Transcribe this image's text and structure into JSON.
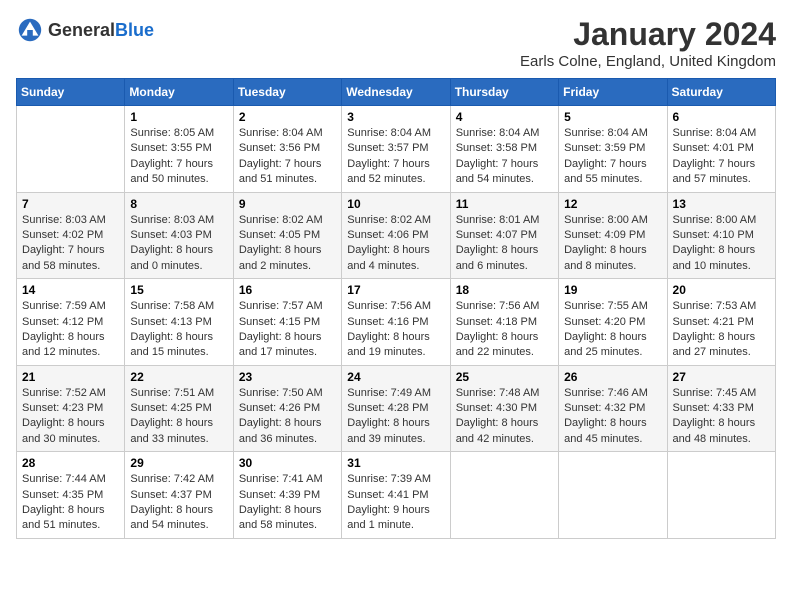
{
  "header": {
    "logo_general": "General",
    "logo_blue": "Blue",
    "month_year": "January 2024",
    "location": "Earls Colne, England, United Kingdom"
  },
  "days_of_week": [
    "Sunday",
    "Monday",
    "Tuesday",
    "Wednesday",
    "Thursday",
    "Friday",
    "Saturday"
  ],
  "weeks": [
    [
      {
        "day": "",
        "sunrise": "",
        "sunset": "",
        "daylight": ""
      },
      {
        "day": "1",
        "sunrise": "Sunrise: 8:05 AM",
        "sunset": "Sunset: 3:55 PM",
        "daylight": "Daylight: 7 hours and 50 minutes."
      },
      {
        "day": "2",
        "sunrise": "Sunrise: 8:04 AM",
        "sunset": "Sunset: 3:56 PM",
        "daylight": "Daylight: 7 hours and 51 minutes."
      },
      {
        "day": "3",
        "sunrise": "Sunrise: 8:04 AM",
        "sunset": "Sunset: 3:57 PM",
        "daylight": "Daylight: 7 hours and 52 minutes."
      },
      {
        "day": "4",
        "sunrise": "Sunrise: 8:04 AM",
        "sunset": "Sunset: 3:58 PM",
        "daylight": "Daylight: 7 hours and 54 minutes."
      },
      {
        "day": "5",
        "sunrise": "Sunrise: 8:04 AM",
        "sunset": "Sunset: 3:59 PM",
        "daylight": "Daylight: 7 hours and 55 minutes."
      },
      {
        "day": "6",
        "sunrise": "Sunrise: 8:04 AM",
        "sunset": "Sunset: 4:01 PM",
        "daylight": "Daylight: 7 hours and 57 minutes."
      }
    ],
    [
      {
        "day": "7",
        "sunrise": "Sunrise: 8:03 AM",
        "sunset": "Sunset: 4:02 PM",
        "daylight": "Daylight: 7 hours and 58 minutes."
      },
      {
        "day": "8",
        "sunrise": "Sunrise: 8:03 AM",
        "sunset": "Sunset: 4:03 PM",
        "daylight": "Daylight: 8 hours and 0 minutes."
      },
      {
        "day": "9",
        "sunrise": "Sunrise: 8:02 AM",
        "sunset": "Sunset: 4:05 PM",
        "daylight": "Daylight: 8 hours and 2 minutes."
      },
      {
        "day": "10",
        "sunrise": "Sunrise: 8:02 AM",
        "sunset": "Sunset: 4:06 PM",
        "daylight": "Daylight: 8 hours and 4 minutes."
      },
      {
        "day": "11",
        "sunrise": "Sunrise: 8:01 AM",
        "sunset": "Sunset: 4:07 PM",
        "daylight": "Daylight: 8 hours and 6 minutes."
      },
      {
        "day": "12",
        "sunrise": "Sunrise: 8:00 AM",
        "sunset": "Sunset: 4:09 PM",
        "daylight": "Daylight: 8 hours and 8 minutes."
      },
      {
        "day": "13",
        "sunrise": "Sunrise: 8:00 AM",
        "sunset": "Sunset: 4:10 PM",
        "daylight": "Daylight: 8 hours and 10 minutes."
      }
    ],
    [
      {
        "day": "14",
        "sunrise": "Sunrise: 7:59 AM",
        "sunset": "Sunset: 4:12 PM",
        "daylight": "Daylight: 8 hours and 12 minutes."
      },
      {
        "day": "15",
        "sunrise": "Sunrise: 7:58 AM",
        "sunset": "Sunset: 4:13 PM",
        "daylight": "Daylight: 8 hours and 15 minutes."
      },
      {
        "day": "16",
        "sunrise": "Sunrise: 7:57 AM",
        "sunset": "Sunset: 4:15 PM",
        "daylight": "Daylight: 8 hours and 17 minutes."
      },
      {
        "day": "17",
        "sunrise": "Sunrise: 7:56 AM",
        "sunset": "Sunset: 4:16 PM",
        "daylight": "Daylight: 8 hours and 19 minutes."
      },
      {
        "day": "18",
        "sunrise": "Sunrise: 7:56 AM",
        "sunset": "Sunset: 4:18 PM",
        "daylight": "Daylight: 8 hours and 22 minutes."
      },
      {
        "day": "19",
        "sunrise": "Sunrise: 7:55 AM",
        "sunset": "Sunset: 4:20 PM",
        "daylight": "Daylight: 8 hours and 25 minutes."
      },
      {
        "day": "20",
        "sunrise": "Sunrise: 7:53 AM",
        "sunset": "Sunset: 4:21 PM",
        "daylight": "Daylight: 8 hours and 27 minutes."
      }
    ],
    [
      {
        "day": "21",
        "sunrise": "Sunrise: 7:52 AM",
        "sunset": "Sunset: 4:23 PM",
        "daylight": "Daylight: 8 hours and 30 minutes."
      },
      {
        "day": "22",
        "sunrise": "Sunrise: 7:51 AM",
        "sunset": "Sunset: 4:25 PM",
        "daylight": "Daylight: 8 hours and 33 minutes."
      },
      {
        "day": "23",
        "sunrise": "Sunrise: 7:50 AM",
        "sunset": "Sunset: 4:26 PM",
        "daylight": "Daylight: 8 hours and 36 minutes."
      },
      {
        "day": "24",
        "sunrise": "Sunrise: 7:49 AM",
        "sunset": "Sunset: 4:28 PM",
        "daylight": "Daylight: 8 hours and 39 minutes."
      },
      {
        "day": "25",
        "sunrise": "Sunrise: 7:48 AM",
        "sunset": "Sunset: 4:30 PM",
        "daylight": "Daylight: 8 hours and 42 minutes."
      },
      {
        "day": "26",
        "sunrise": "Sunrise: 7:46 AM",
        "sunset": "Sunset: 4:32 PM",
        "daylight": "Daylight: 8 hours and 45 minutes."
      },
      {
        "day": "27",
        "sunrise": "Sunrise: 7:45 AM",
        "sunset": "Sunset: 4:33 PM",
        "daylight": "Daylight: 8 hours and 48 minutes."
      }
    ],
    [
      {
        "day": "28",
        "sunrise": "Sunrise: 7:44 AM",
        "sunset": "Sunset: 4:35 PM",
        "daylight": "Daylight: 8 hours and 51 minutes."
      },
      {
        "day": "29",
        "sunrise": "Sunrise: 7:42 AM",
        "sunset": "Sunset: 4:37 PM",
        "daylight": "Daylight: 8 hours and 54 minutes."
      },
      {
        "day": "30",
        "sunrise": "Sunrise: 7:41 AM",
        "sunset": "Sunset: 4:39 PM",
        "daylight": "Daylight: 8 hours and 58 minutes."
      },
      {
        "day": "31",
        "sunrise": "Sunrise: 7:39 AM",
        "sunset": "Sunset: 4:41 PM",
        "daylight": "Daylight: 9 hours and 1 minute."
      },
      {
        "day": "",
        "sunrise": "",
        "sunset": "",
        "daylight": ""
      },
      {
        "day": "",
        "sunrise": "",
        "sunset": "",
        "daylight": ""
      },
      {
        "day": "",
        "sunrise": "",
        "sunset": "",
        "daylight": ""
      }
    ]
  ]
}
